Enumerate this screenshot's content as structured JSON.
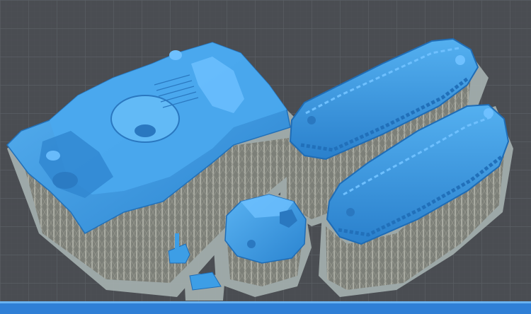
{
  "scene": {
    "background_color": "#4a4d52",
    "grid_color": "#5a5e64",
    "plate_edge_color": "#2f7fd6",
    "raft_color": "#9aa8a8",
    "support_color": "#8d8f86",
    "model_color": "#3d9ee6",
    "model_shadow_color": "#2a78c0",
    "model_highlight_color": "#6ec0ff"
  },
  "objects": [
    {
      "label": "tank-hull",
      "icon": "tank-hull-icon"
    },
    {
      "label": "turret",
      "icon": "turret-icon"
    },
    {
      "label": "left-track",
      "icon": "track-icon"
    },
    {
      "label": "right-track",
      "icon": "track-icon"
    },
    {
      "label": "small-part-hatch",
      "icon": "part-icon"
    },
    {
      "label": "small-part-plate",
      "icon": "part-icon"
    }
  ]
}
